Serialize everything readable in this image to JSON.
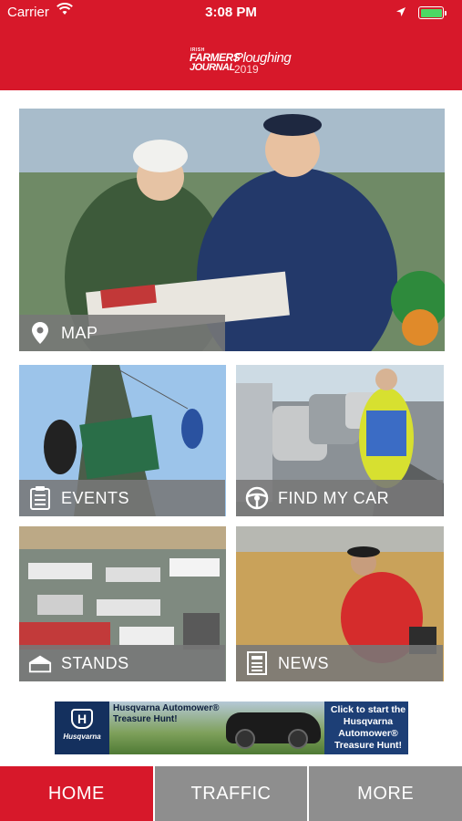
{
  "status_bar": {
    "carrier": "Carrier",
    "time": "3:08 PM",
    "battery_level": 1.0
  },
  "header": {
    "logo": {
      "line1": "IRISH",
      "line2": "FARMERS",
      "line3": "JOURNAL",
      "line4": "Ploughing",
      "year": "2019"
    },
    "bg_color": "#d7182a"
  },
  "tiles": {
    "map": {
      "label": "MAP",
      "icon": "location-pin-icon"
    },
    "events": {
      "label": "EVENTS",
      "icon": "clipboard-icon"
    },
    "find_my_car": {
      "label": "FIND MY CAR",
      "icon": "steering-wheel-icon"
    },
    "stands": {
      "label": "STANDS",
      "icon": "tent-icon"
    },
    "news": {
      "label": "NEWS",
      "icon": "document-icon"
    }
  },
  "banner": {
    "brand": "Husqvarna",
    "headline": "Husqvarna Automower® Treasure Hunt!",
    "cta": "Click to start the Husqvarna Automower® Treasure Hunt!"
  },
  "tabs": [
    {
      "label": "HOME",
      "active": true
    },
    {
      "label": "TRAFFIC",
      "active": false
    },
    {
      "label": "MORE",
      "active": false
    }
  ],
  "colors": {
    "accent": "#d7182a",
    "tab_inactive": "#8e8e8e",
    "tile_bar": "#787878"
  }
}
